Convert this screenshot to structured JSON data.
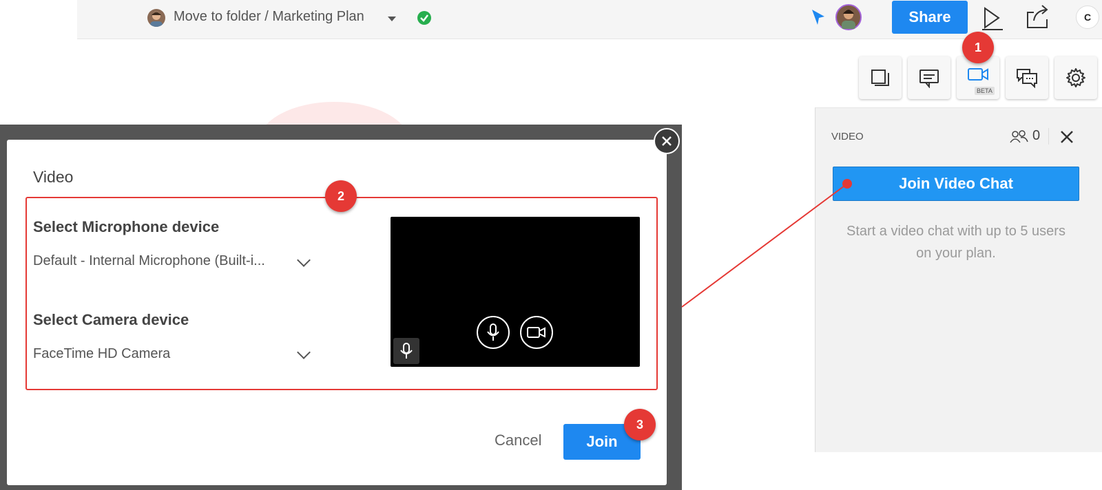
{
  "topbar": {
    "breadcrumb": "Move to folder / Marketing Plan",
    "share_label": "Share",
    "app_logo_letter": "C",
    "icons": [
      "user-avatar-icon",
      "caret-down-icon",
      "saved-check-icon",
      "cursor-icon",
      "play-icon",
      "export-icon"
    ]
  },
  "toolbar": {
    "buttons": [
      "pages-icon",
      "comments-icon",
      "video-icon",
      "chat-icon",
      "settings-icon"
    ],
    "beta_label": "BETA"
  },
  "callouts": {
    "one": "1",
    "two": "2",
    "three": "3"
  },
  "video_panel": {
    "title": "VIDEO",
    "participant_count": "0",
    "join_label": "Join Video Chat",
    "description": "Start a video chat with up to 5 users on your plan."
  },
  "modal": {
    "title": "Video",
    "mic_label": "Select Microphone device",
    "mic_value": "Default - Internal Microphone (Built-i...",
    "camera_label": "Select Camera device",
    "camera_value": "FaceTime HD Camera",
    "cancel_label": "Cancel",
    "join_label": "Join"
  },
  "colors": {
    "accent_blue": "#1e88f0",
    "callout_red": "#e53935",
    "success_green": "#27ae4e"
  }
}
